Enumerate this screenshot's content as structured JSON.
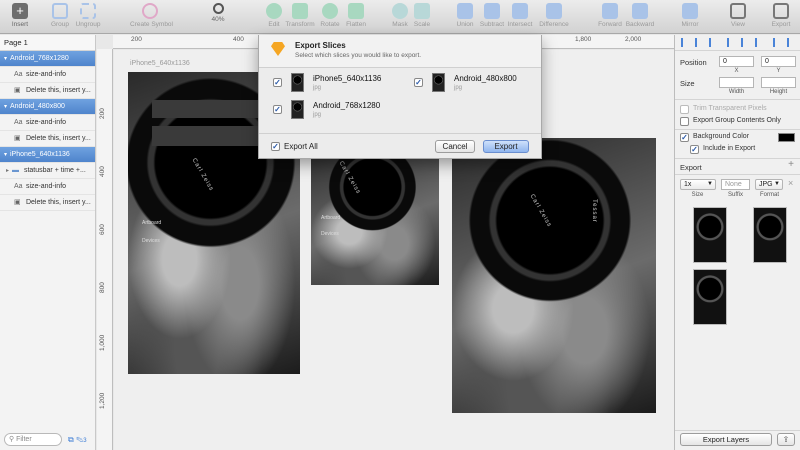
{
  "toolbar": {
    "insert": "Insert",
    "group": "Group",
    "ungroup": "Ungroup",
    "create_symbol": "Create Symbol",
    "zoom": "40%",
    "edit": "Edit",
    "transform": "Transform",
    "rotate": "Rotate",
    "flatten": "Flatten",
    "mask": "Mask",
    "scale": "Scale",
    "union": "Union",
    "subtract": "Subtract",
    "intersect": "Intersect",
    "difference": "Difference",
    "forward": "Forward",
    "backward": "Backward",
    "mirror": "Mirror",
    "view": "View",
    "export": "Export"
  },
  "layers": {
    "page": "Page 1",
    "items": [
      {
        "label": "Android_768x1280",
        "kind": "artboard"
      },
      {
        "label": "size-and-info",
        "kind": "text"
      },
      {
        "label": "Delete this, insert y...",
        "kind": "image"
      },
      {
        "label": "Android_480x800",
        "kind": "artboard"
      },
      {
        "label": "size-and-info",
        "kind": "text"
      },
      {
        "label": "Delete this, insert y...",
        "kind": "image"
      },
      {
        "label": "iPhone5_640x1136",
        "kind": "artboard"
      },
      {
        "label": "statusbar + time +...",
        "kind": "group"
      },
      {
        "label": "size-and-info",
        "kind": "text"
      },
      {
        "label": "Delete this, insert y...",
        "kind": "image"
      }
    ],
    "filter_placeholder": "Filter",
    "count": "3"
  },
  "rulers": {
    "top": [
      "200",
      "400",
      "1,800",
      "2,000"
    ],
    "left": [
      "200",
      "400",
      "600",
      "800",
      "1,000",
      "1,200"
    ]
  },
  "canvas": {
    "artboard_label": "iPhone5_640x1136",
    "overlay": {
      "artboard_title": "Artboard",
      "devices_title": "Devices"
    }
  },
  "dialog": {
    "title": "Export Slices",
    "subtitle": "Select which slices you would like to export.",
    "slices": [
      {
        "name": "iPhone5_640x1136",
        "ext": "jpg",
        "checked": true
      },
      {
        "name": "Android_480x800",
        "ext": "jpg",
        "checked": true
      },
      {
        "name": "Android_768x1280",
        "ext": "jpg",
        "checked": true
      }
    ],
    "export_all": "Export All",
    "cancel": "Cancel",
    "export": "Export"
  },
  "inspector": {
    "position": "Position",
    "x_value": "0",
    "y_value": "0",
    "x": "X",
    "y": "Y",
    "size": "Size",
    "width": "Width",
    "height": "Height",
    "trim": "Trim Transparent Pixels",
    "export_group": "Export Group Contents Only",
    "background_color": "Background Color",
    "include_in_export": "Include in Export",
    "background_hex": "#000000",
    "export_section": "Export",
    "scale": "1x",
    "suffix_placeholder": "None",
    "format": "JPG",
    "scale_label": "Size",
    "suffix_label": "Suffix",
    "format_label": "Format",
    "export_layers": "Export Layers"
  }
}
